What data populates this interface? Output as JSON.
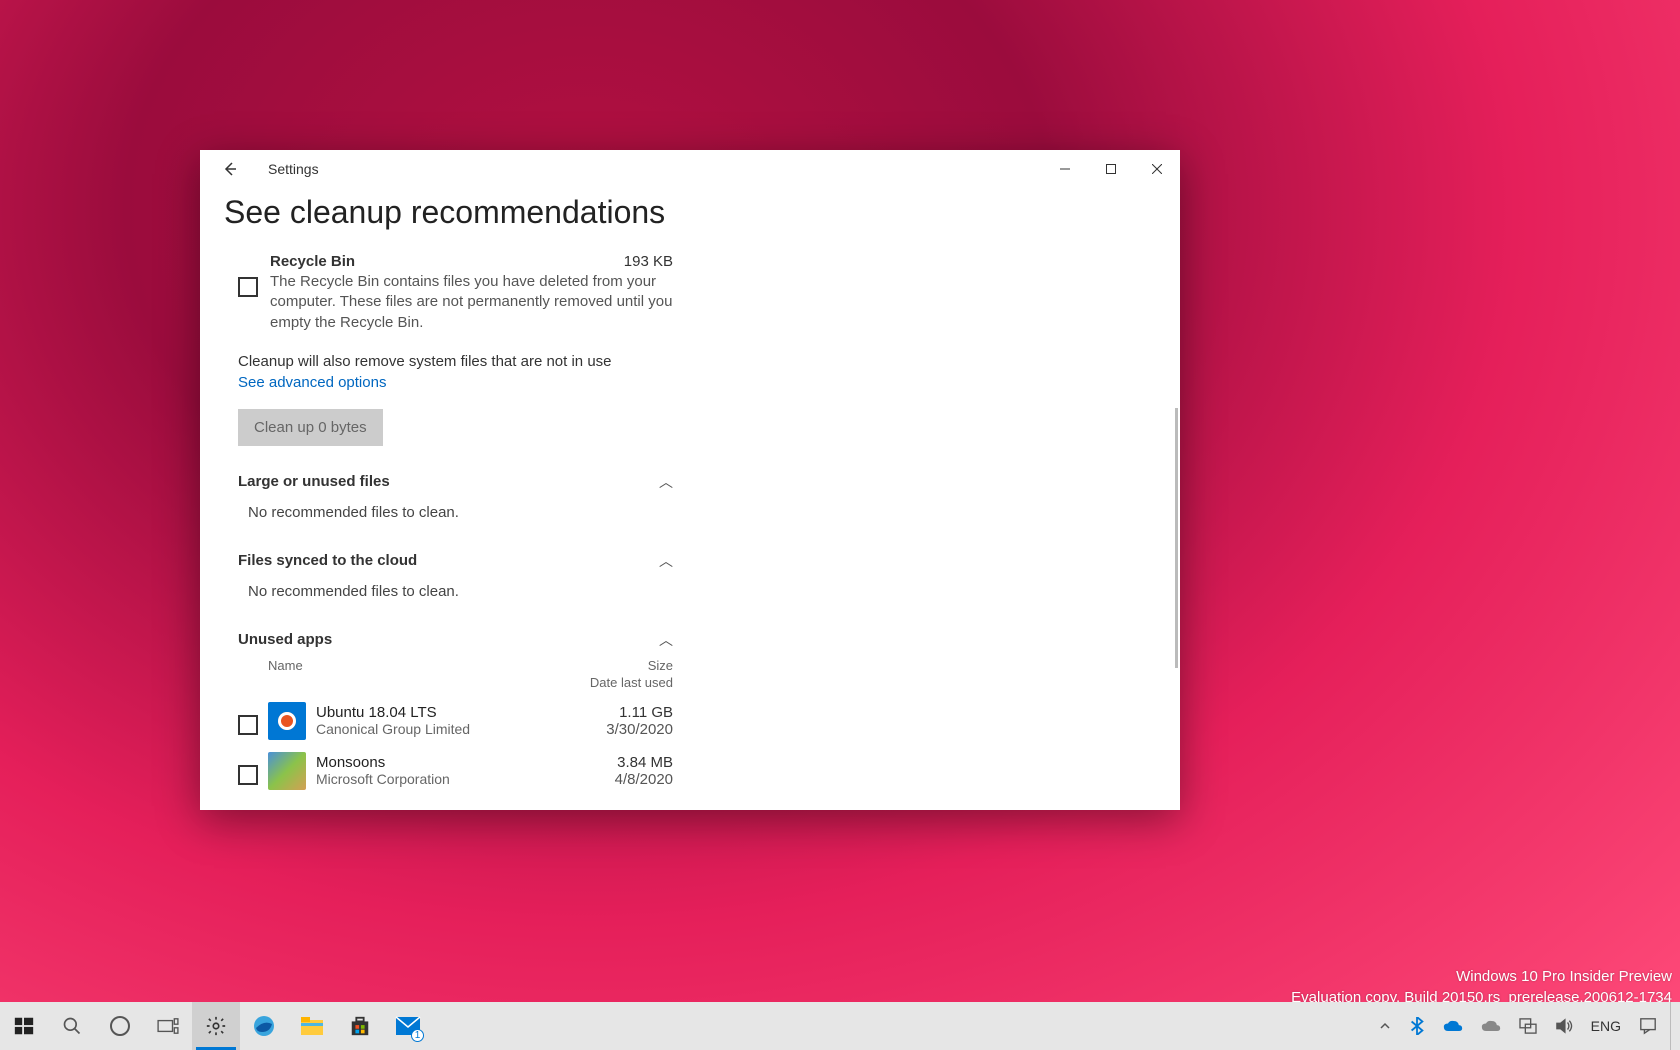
{
  "window": {
    "title": "Settings"
  },
  "page": {
    "heading": "See cleanup recommendations",
    "recycle_bin": {
      "name": "Recycle Bin",
      "size": "193 KB",
      "description": "The Recycle Bin contains files you have deleted from your computer. These files are not permanently removed until you empty the Recycle Bin."
    },
    "cleanup_note": "Cleanup will also remove system files that are not in use",
    "advanced_link": "See advanced options",
    "cleanup_button": "Clean up 0 bytes",
    "sections": {
      "large": {
        "title": "Large or unused files",
        "empty_msg": "No recommended files to clean."
      },
      "cloud": {
        "title": "Files synced to the cloud",
        "empty_msg": "No recommended files to clean."
      },
      "unused": {
        "title": "Unused apps"
      }
    },
    "app_table_headers": {
      "name": "Name",
      "size": "Size",
      "date": "Date last used"
    },
    "apps": [
      {
        "name": "Ubuntu 18.04 LTS",
        "publisher": "Canonical Group Limited",
        "size": "1.11 GB",
        "date": "3/30/2020",
        "icon": "ubuntu"
      },
      {
        "name": "Monsoons",
        "publisher": "Microsoft Corporation",
        "size": "3.84 MB",
        "date": "4/8/2020",
        "icon": "monsoons"
      }
    ]
  },
  "watermark": {
    "line1": "Windows 10 Pro Insider Preview",
    "line2": "Evaluation copy. Build 20150.rs_prerelease.200612-1734"
  },
  "taskbar": {
    "mail_badge": "1",
    "lang": "ENG"
  }
}
